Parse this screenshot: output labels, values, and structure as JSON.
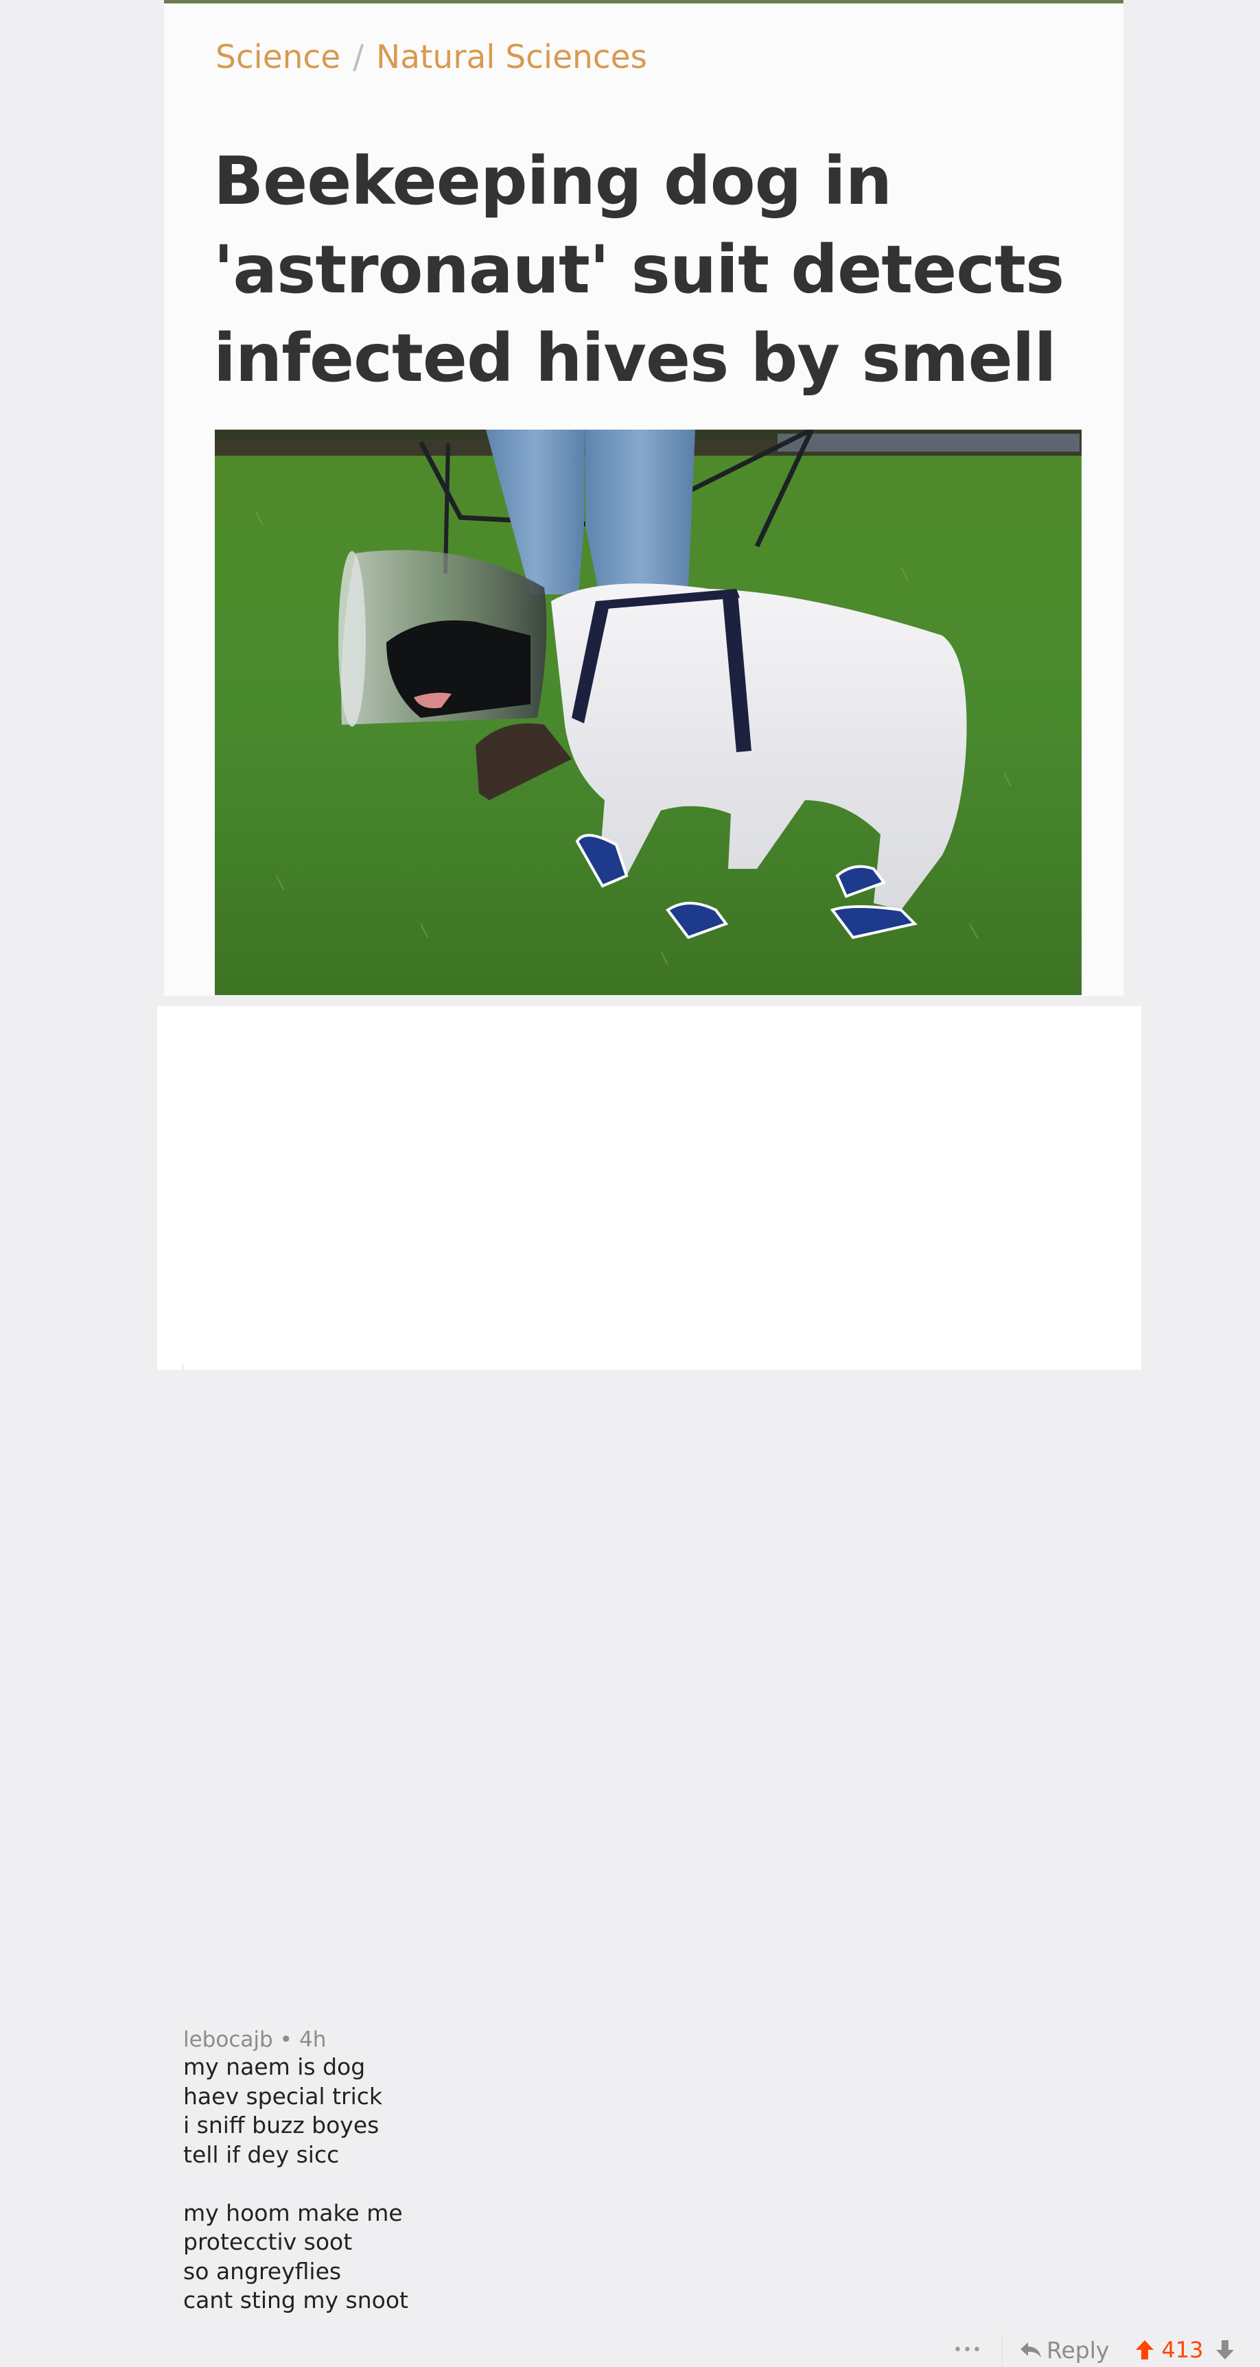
{
  "article": {
    "breadcrumb": {
      "section": "Science",
      "separator": "/",
      "subsection": "Natural Sciences"
    },
    "headline": "Beekeeping dog in 'astronaut' suit detects infected hives by smell",
    "image_subject": "dog in white bee suit with clear cone helmet and blue booties on grass, on a leash"
  },
  "comment": {
    "username": "lebocajb",
    "meta_separator": "•",
    "age": "4h",
    "stanza1": [
      "my naem is dog",
      "haev special trick",
      "i sniff buzz boyes",
      "tell if dey sicc"
    ],
    "stanza2": [
      "my hoom make me",
      "protecctiv soot",
      "so angreyflies",
      "cant sting my snoot"
    ],
    "more_label": "•••",
    "reply_label": "Reply",
    "score": "413"
  },
  "colors": {
    "accent": "#ff4500",
    "breadcrumb": "#d89a4e",
    "headline": "#333333"
  },
  "icons": [
    "reply-arrow-icon",
    "upvote-arrow-icon",
    "downvote-arrow-icon"
  ]
}
